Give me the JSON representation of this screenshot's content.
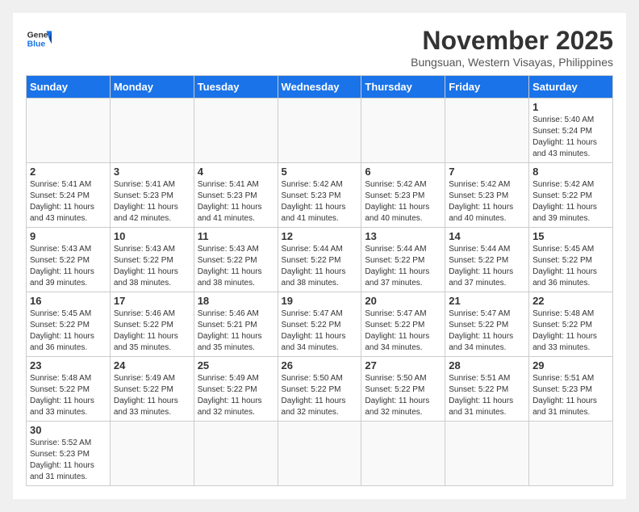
{
  "header": {
    "logo_general": "General",
    "logo_blue": "Blue",
    "month_title": "November 2025",
    "subtitle": "Bungsuan, Western Visayas, Philippines"
  },
  "days_of_week": [
    "Sunday",
    "Monday",
    "Tuesday",
    "Wednesday",
    "Thursday",
    "Friday",
    "Saturday"
  ],
  "weeks": [
    [
      {
        "day": "",
        "info": ""
      },
      {
        "day": "",
        "info": ""
      },
      {
        "day": "",
        "info": ""
      },
      {
        "day": "",
        "info": ""
      },
      {
        "day": "",
        "info": ""
      },
      {
        "day": "",
        "info": ""
      },
      {
        "day": "1",
        "info": "Sunrise: 5:40 AM\nSunset: 5:24 PM\nDaylight: 11 hours\nand 43 minutes."
      }
    ],
    [
      {
        "day": "2",
        "info": "Sunrise: 5:41 AM\nSunset: 5:24 PM\nDaylight: 11 hours\nand 43 minutes."
      },
      {
        "day": "3",
        "info": "Sunrise: 5:41 AM\nSunset: 5:23 PM\nDaylight: 11 hours\nand 42 minutes."
      },
      {
        "day": "4",
        "info": "Sunrise: 5:41 AM\nSunset: 5:23 PM\nDaylight: 11 hours\nand 41 minutes."
      },
      {
        "day": "5",
        "info": "Sunrise: 5:42 AM\nSunset: 5:23 PM\nDaylight: 11 hours\nand 41 minutes."
      },
      {
        "day": "6",
        "info": "Sunrise: 5:42 AM\nSunset: 5:23 PM\nDaylight: 11 hours\nand 40 minutes."
      },
      {
        "day": "7",
        "info": "Sunrise: 5:42 AM\nSunset: 5:23 PM\nDaylight: 11 hours\nand 40 minutes."
      },
      {
        "day": "8",
        "info": "Sunrise: 5:42 AM\nSunset: 5:22 PM\nDaylight: 11 hours\nand 39 minutes."
      }
    ],
    [
      {
        "day": "9",
        "info": "Sunrise: 5:43 AM\nSunset: 5:22 PM\nDaylight: 11 hours\nand 39 minutes."
      },
      {
        "day": "10",
        "info": "Sunrise: 5:43 AM\nSunset: 5:22 PM\nDaylight: 11 hours\nand 38 minutes."
      },
      {
        "day": "11",
        "info": "Sunrise: 5:43 AM\nSunset: 5:22 PM\nDaylight: 11 hours\nand 38 minutes."
      },
      {
        "day": "12",
        "info": "Sunrise: 5:44 AM\nSunset: 5:22 PM\nDaylight: 11 hours\nand 38 minutes."
      },
      {
        "day": "13",
        "info": "Sunrise: 5:44 AM\nSunset: 5:22 PM\nDaylight: 11 hours\nand 37 minutes."
      },
      {
        "day": "14",
        "info": "Sunrise: 5:44 AM\nSunset: 5:22 PM\nDaylight: 11 hours\nand 37 minutes."
      },
      {
        "day": "15",
        "info": "Sunrise: 5:45 AM\nSunset: 5:22 PM\nDaylight: 11 hours\nand 36 minutes."
      }
    ],
    [
      {
        "day": "16",
        "info": "Sunrise: 5:45 AM\nSunset: 5:22 PM\nDaylight: 11 hours\nand 36 minutes."
      },
      {
        "day": "17",
        "info": "Sunrise: 5:46 AM\nSunset: 5:22 PM\nDaylight: 11 hours\nand 35 minutes."
      },
      {
        "day": "18",
        "info": "Sunrise: 5:46 AM\nSunset: 5:21 PM\nDaylight: 11 hours\nand 35 minutes."
      },
      {
        "day": "19",
        "info": "Sunrise: 5:47 AM\nSunset: 5:22 PM\nDaylight: 11 hours\nand 34 minutes."
      },
      {
        "day": "20",
        "info": "Sunrise: 5:47 AM\nSunset: 5:22 PM\nDaylight: 11 hours\nand 34 minutes."
      },
      {
        "day": "21",
        "info": "Sunrise: 5:47 AM\nSunset: 5:22 PM\nDaylight: 11 hours\nand 34 minutes."
      },
      {
        "day": "22",
        "info": "Sunrise: 5:48 AM\nSunset: 5:22 PM\nDaylight: 11 hours\nand 33 minutes."
      }
    ],
    [
      {
        "day": "23",
        "info": "Sunrise: 5:48 AM\nSunset: 5:22 PM\nDaylight: 11 hours\nand 33 minutes."
      },
      {
        "day": "24",
        "info": "Sunrise: 5:49 AM\nSunset: 5:22 PM\nDaylight: 11 hours\nand 33 minutes."
      },
      {
        "day": "25",
        "info": "Sunrise: 5:49 AM\nSunset: 5:22 PM\nDaylight: 11 hours\nand 32 minutes."
      },
      {
        "day": "26",
        "info": "Sunrise: 5:50 AM\nSunset: 5:22 PM\nDaylight: 11 hours\nand 32 minutes."
      },
      {
        "day": "27",
        "info": "Sunrise: 5:50 AM\nSunset: 5:22 PM\nDaylight: 11 hours\nand 32 minutes."
      },
      {
        "day": "28",
        "info": "Sunrise: 5:51 AM\nSunset: 5:22 PM\nDaylight: 11 hours\nand 31 minutes."
      },
      {
        "day": "29",
        "info": "Sunrise: 5:51 AM\nSunset: 5:23 PM\nDaylight: 11 hours\nand 31 minutes."
      }
    ],
    [
      {
        "day": "30",
        "info": "Sunrise: 5:52 AM\nSunset: 5:23 PM\nDaylight: 11 hours\nand 31 minutes."
      },
      {
        "day": "",
        "info": ""
      },
      {
        "day": "",
        "info": ""
      },
      {
        "day": "",
        "info": ""
      },
      {
        "day": "",
        "info": ""
      },
      {
        "day": "",
        "info": ""
      },
      {
        "day": "",
        "info": ""
      }
    ]
  ]
}
